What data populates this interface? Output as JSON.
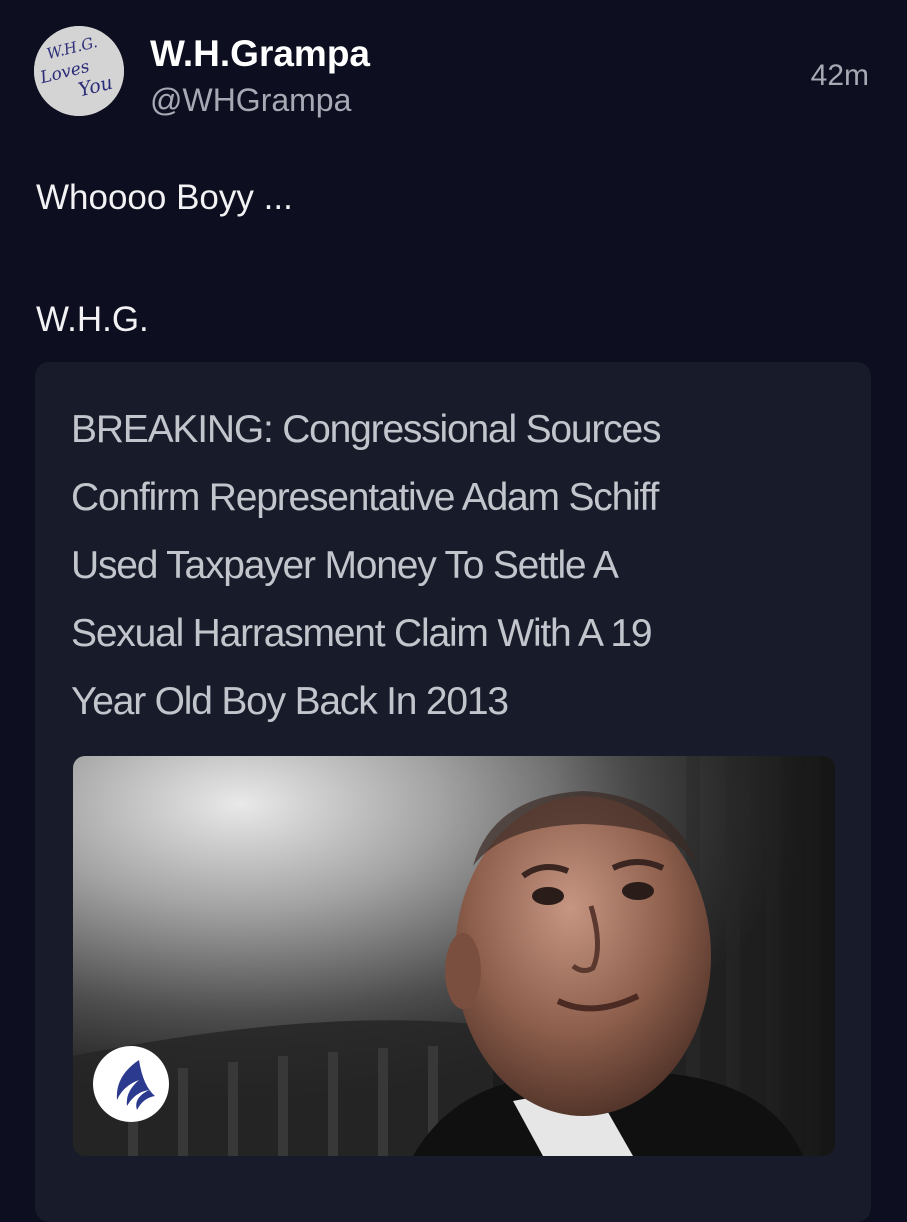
{
  "post": {
    "display_name": "W.H.Grampa",
    "handle": "@WHGrampa",
    "timestamp": "42m",
    "avatar_text": [
      "W.H.G.",
      "Loves",
      "You"
    ],
    "body_lines": [
      "Whoooo Boyy ...",
      "W.H.G."
    ]
  },
  "card": {
    "headline_lines": [
      "BREAKING: Congressional Sources",
      "Confirm Representative Adam Schiff",
      "Used Taxpayer Money To Settle A",
      "Sexual Harrasment Claim With A 19",
      "Year Old Boy Back In 2013"
    ],
    "photo_icon": "portrait-photo",
    "logo_icon": "eagle-wing-logo-icon"
  },
  "colors": {
    "background": "#0d0e1f",
    "card_background": "#181c2a",
    "secondary_text": "#a7a9b4",
    "headline_text": "#c3c5cc",
    "logo_blue": "#2b3a8f"
  }
}
